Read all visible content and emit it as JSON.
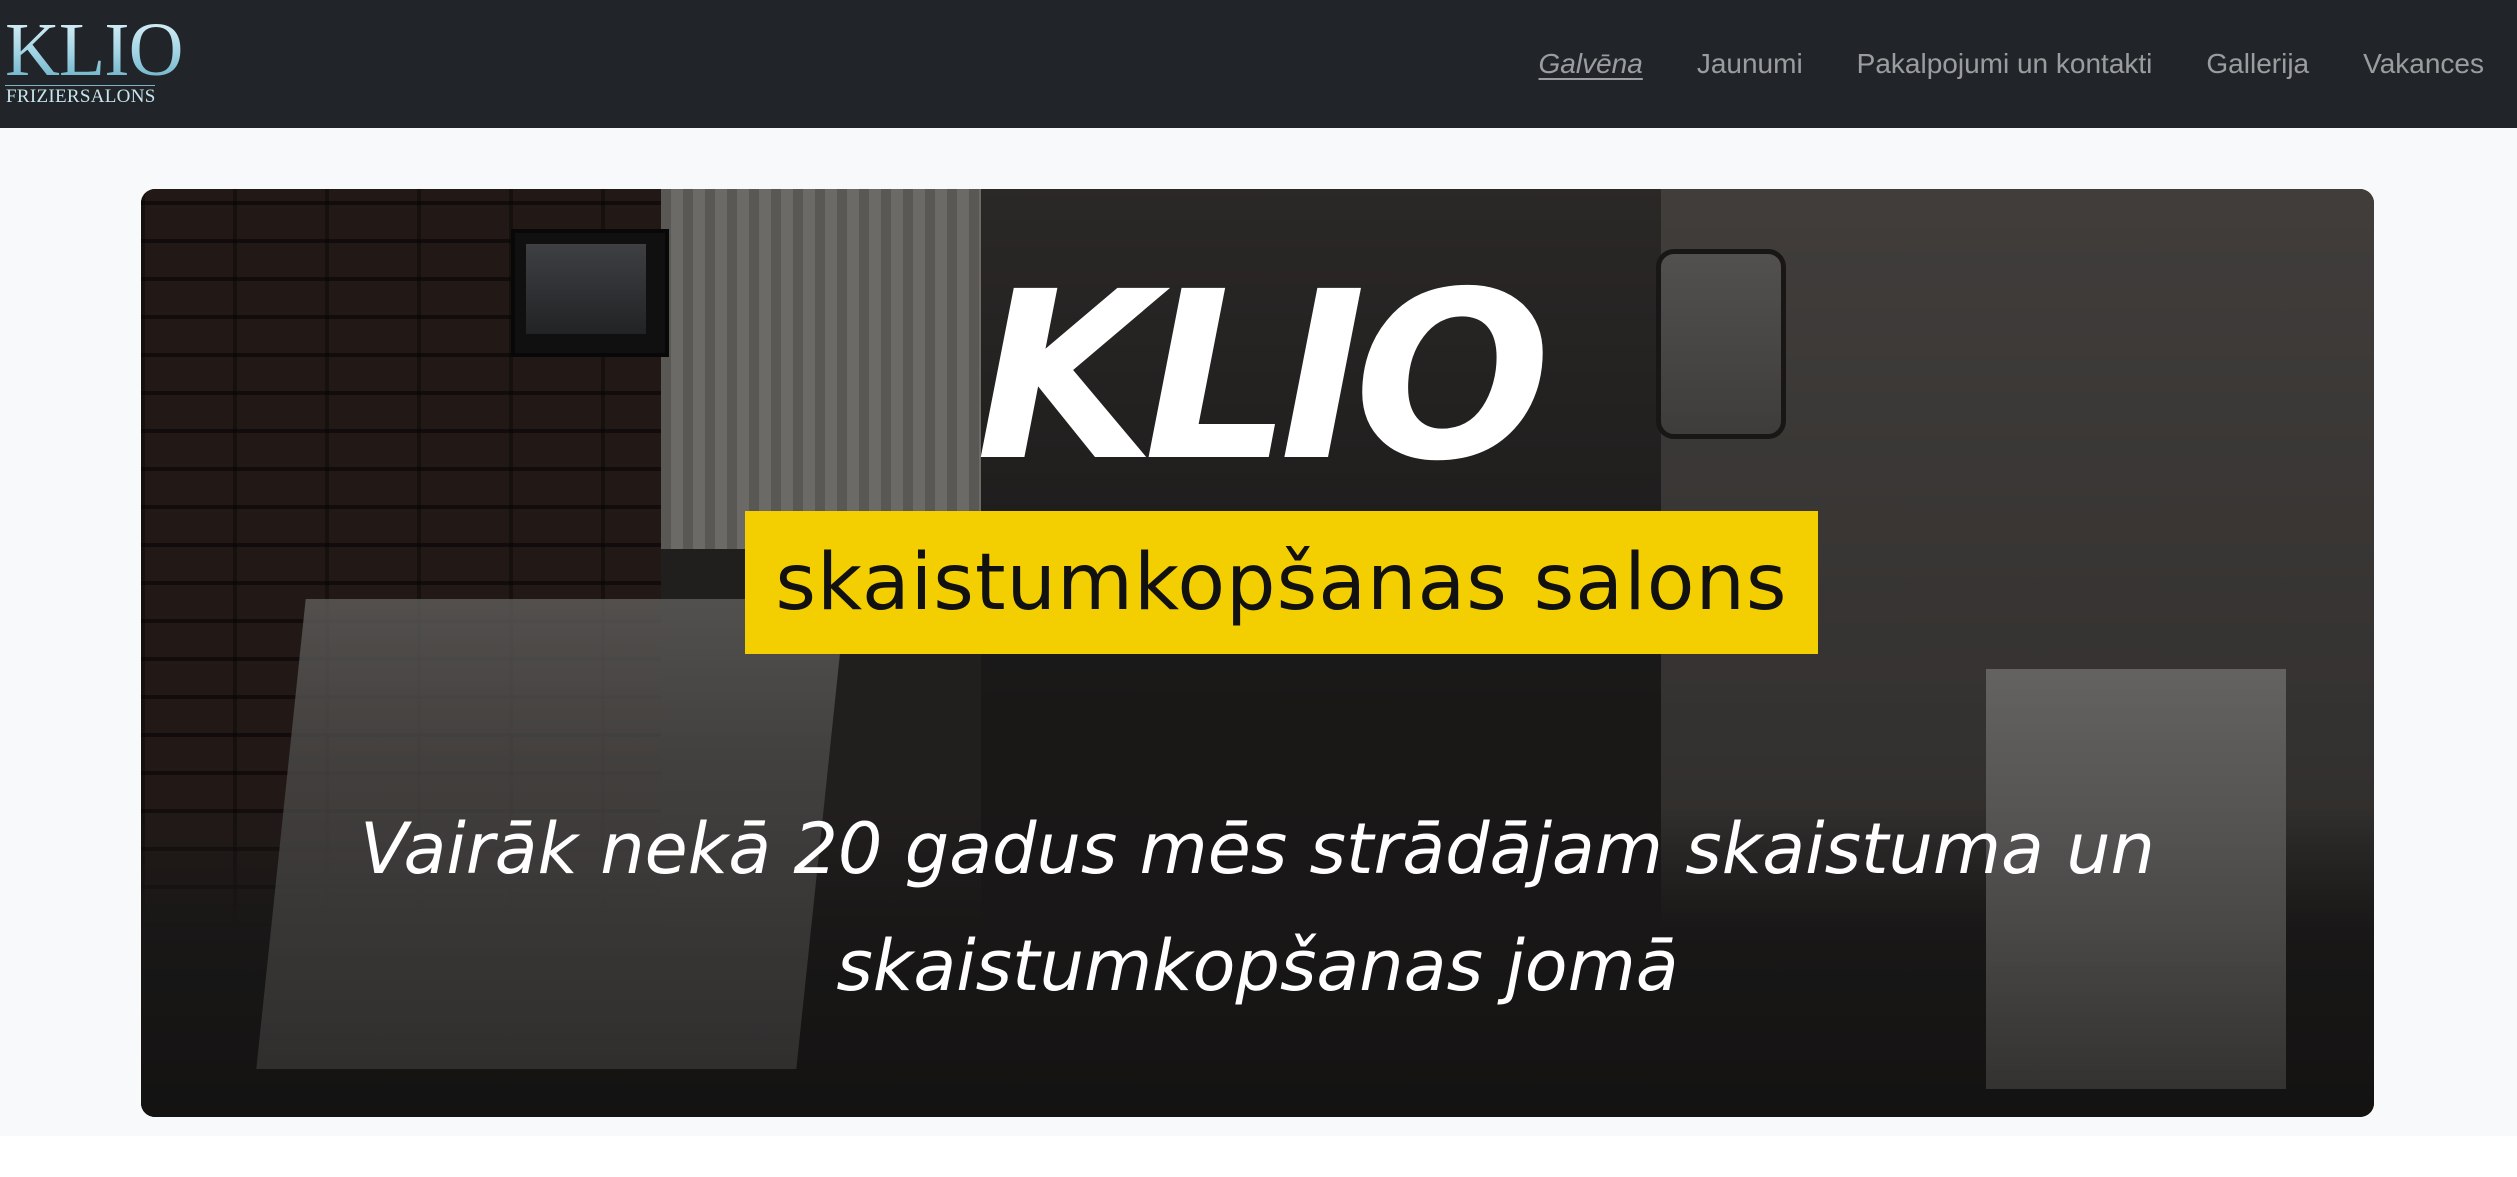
{
  "brand": {
    "name": "KLIO",
    "subtitle": "FRIZIERSALONS"
  },
  "nav": {
    "items": [
      {
        "label": "Galvēna",
        "active": true
      },
      {
        "label": "Jaunumi",
        "active": false
      },
      {
        "label": "Pakalpojumi un kontakti",
        "active": false
      },
      {
        "label": "Gallerija",
        "active": false
      },
      {
        "label": "Vakances",
        "active": false
      }
    ]
  },
  "hero": {
    "title": "KLIO",
    "badge": "skaistumkopšanas salons",
    "tagline": "Vairāk nekā 20 gadus mēs strādājam skaistuma un skaistumkopšanas jomā"
  },
  "colors": {
    "navbar_bg": "#212529",
    "page_bg": "#f8f9fa",
    "badge_yellow": "#f3cf02",
    "nav_text": "rgba(255,255,255,0.55)"
  }
}
